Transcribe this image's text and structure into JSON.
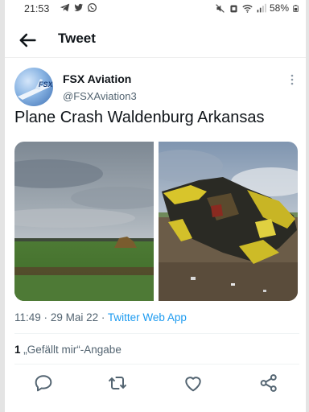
{
  "status_bar": {
    "time": "21:53",
    "battery": "58%",
    "left_icons": [
      "telegram-icon",
      "twitter-icon",
      "whatsapp-icon"
    ],
    "right_icons": [
      "mute-icon",
      "alarm-icon",
      "wifi-icon",
      "signal-icon",
      "battery-icon"
    ]
  },
  "header": {
    "title": "Tweet",
    "back_icon": "back-arrow-icon"
  },
  "tweet": {
    "author_name": "FSX Aviation",
    "author_handle": "@FSXAviation3",
    "avatar_text": "FSX",
    "text": "Plane Crash Waldenburg Arkansas",
    "time": "11:49",
    "separator": "·",
    "date": "29 Mai 22",
    "source": "Twitter Web App",
    "likes_count": "1",
    "likes_label": "„Gefällt mir“-Angabe"
  },
  "actions": [
    "reply-icon",
    "retweet-icon",
    "like-icon",
    "share-icon"
  ],
  "colors": {
    "accent": "#1d9bf0",
    "text_primary": "#0f1419",
    "text_secondary": "#536471",
    "wreck_yellow": "#d8c52b"
  }
}
